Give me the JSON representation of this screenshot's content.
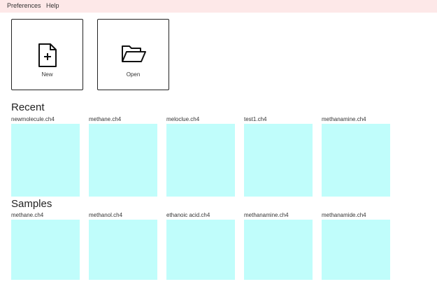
{
  "menu": {
    "preferences": "Preferences",
    "help": "Help"
  },
  "actions": {
    "new_label": "New",
    "open_label": "Open"
  },
  "recent": {
    "title": "Recent",
    "files": [
      "newmolecule.ch4",
      "methane.ch4",
      "meloclue.ch4",
      "test1.ch4",
      "methanamine.ch4"
    ]
  },
  "samples": {
    "title": "Samples",
    "files": [
      "methane.ch4",
      "methanol.ch4",
      "ethanoic acid.ch4",
      "methanamine.ch4",
      "methanamide.ch4"
    ]
  },
  "colors": {
    "menubar_bg": "#fde8e8",
    "thumbnail_bg": "#c0fdfb"
  }
}
